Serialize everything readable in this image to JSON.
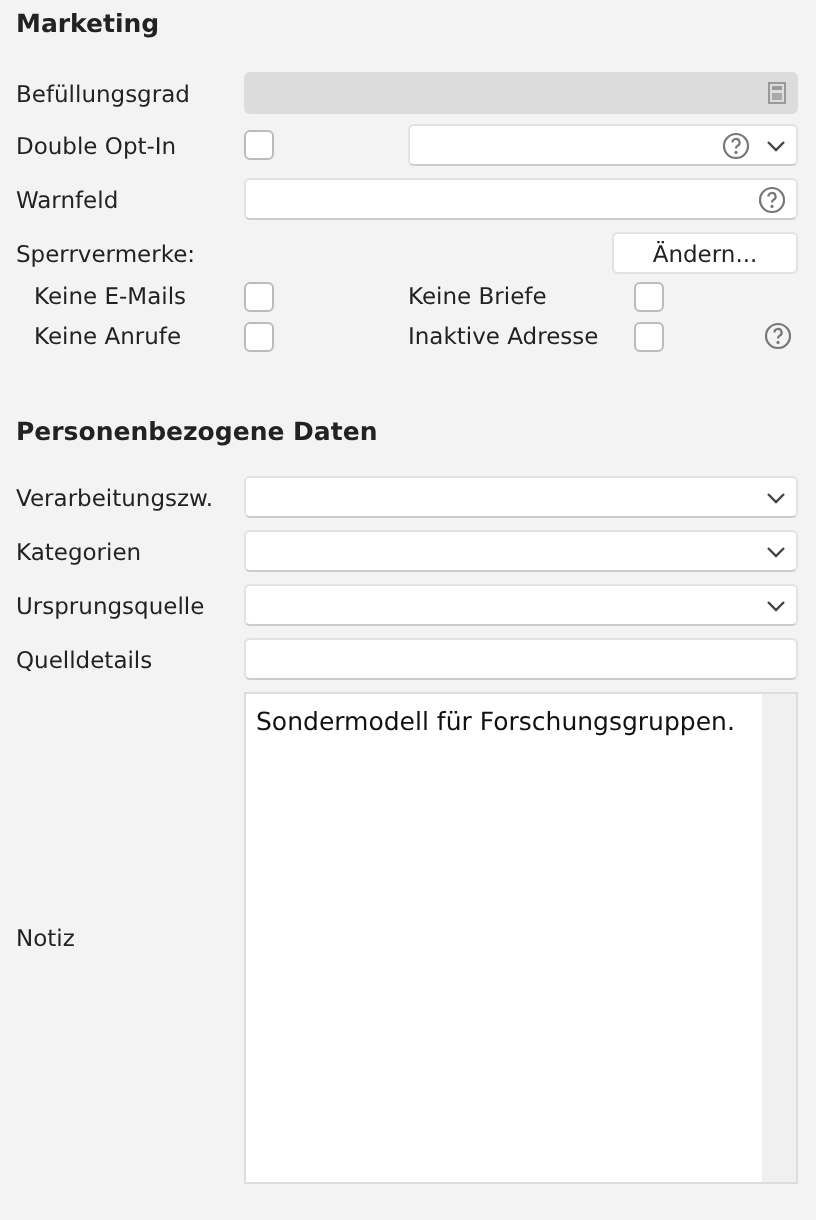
{
  "marketing": {
    "title": "Marketing",
    "fill_level": {
      "label": "Befüllungsgrad",
      "disabled": true
    },
    "double_opt_in": {
      "label": "Double Opt-In",
      "checked": false
    },
    "warning_field": {
      "label": "Warnfeld"
    },
    "blocks": {
      "label": "Sperrvermerke:",
      "button": "Ändern...",
      "options": [
        {
          "label": "Keine E-Mails",
          "checked": false
        },
        {
          "label": "Keine Briefe",
          "checked": false
        },
        {
          "label": "Keine Anrufe",
          "checked": false
        },
        {
          "label": "Inaktive Adresse",
          "checked": false
        }
      ]
    }
  },
  "personal": {
    "title": "Personenbezogene Daten",
    "fields": [
      {
        "label": "Verarbeitungszw.",
        "kind": "select"
      },
      {
        "label": "Kategorien",
        "kind": "select"
      },
      {
        "label": "Ursprungsquelle",
        "kind": "select"
      },
      {
        "label": "Quelldetails",
        "kind": "text"
      }
    ],
    "note": {
      "label": "Notiz",
      "value": "Sondermodell für Forschungsgruppen."
    }
  }
}
